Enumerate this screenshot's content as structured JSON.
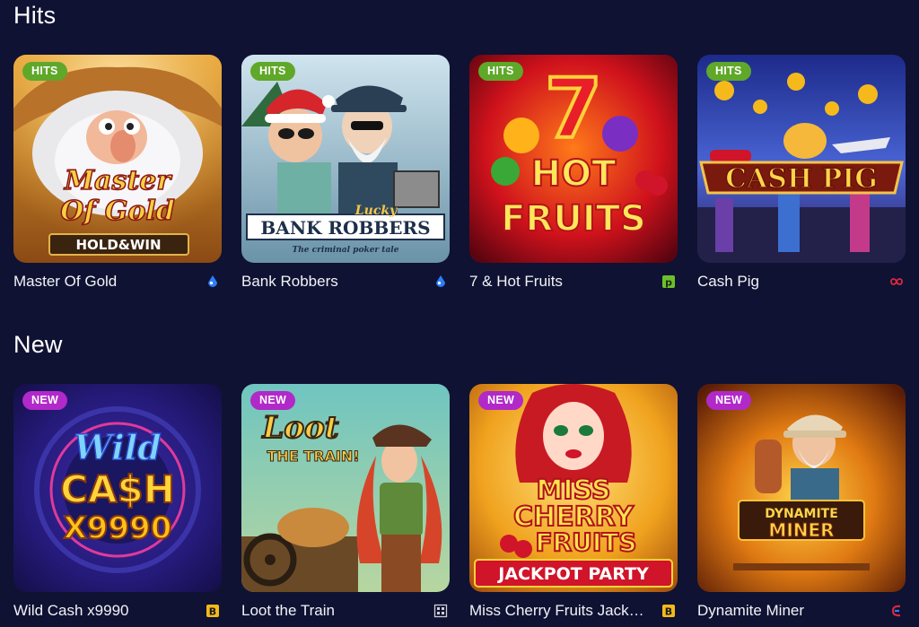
{
  "sections": {
    "hits": {
      "title": "Hits",
      "games": [
        {
          "name": "Master Of Gold",
          "badge": "HITS",
          "provider_icon": "blue-drop-provider-icon",
          "art_lines": [
            "Master",
            "Of Gold",
            "HOLD&WIN"
          ]
        },
        {
          "name": "Bank Robbers",
          "badge": "HITS",
          "provider_icon": "blue-drop-provider-icon",
          "art_lines": [
            "Lucky",
            "BANK ROBBERS",
            "The criminal poker tale"
          ]
        },
        {
          "name": "7 & Hot Fruits",
          "badge": "HITS",
          "provider_icon": "p-provider-icon",
          "art_lines": [
            "7",
            "HOT",
            "FRUITS"
          ]
        },
        {
          "name": "Cash Pig",
          "badge": "HITS",
          "provider_icon": "infinity-provider-icon",
          "art_lines": [
            "CASH PIG"
          ]
        }
      ]
    },
    "new": {
      "title": "New",
      "games": [
        {
          "name": "Wild Cash x9990",
          "badge": "NEW",
          "provider_icon": "b-provider-icon",
          "art_lines": [
            "Wild",
            "CA$H",
            "X9990"
          ]
        },
        {
          "name": "Loot the Train",
          "badge": "NEW",
          "provider_icon": "grid-provider-icon",
          "art_lines": [
            "Loot",
            "THE TRAIN!"
          ]
        },
        {
          "name": "Miss Cherry Fruits Jackp…",
          "badge": "NEW",
          "provider_icon": "b-provider-icon",
          "art_lines": [
            "MISS",
            "CHERRY",
            "FRUITS",
            "JACKPOT PARTY"
          ]
        },
        {
          "name": "Dynamite Miner",
          "badge": "NEW",
          "provider_icon": "e-provider-icon",
          "art_lines": [
            "DYNAMITE",
            "MINER"
          ]
        }
      ]
    }
  },
  "colors": {
    "background": "#0f1232",
    "hits_badge": "#5fa829",
    "new_badge": "#b129c9",
    "provider_blue": "#2d7ff9",
    "provider_yellow": "#f5b91c",
    "provider_green": "#6cbf2a",
    "provider_red": "#d8283e"
  }
}
